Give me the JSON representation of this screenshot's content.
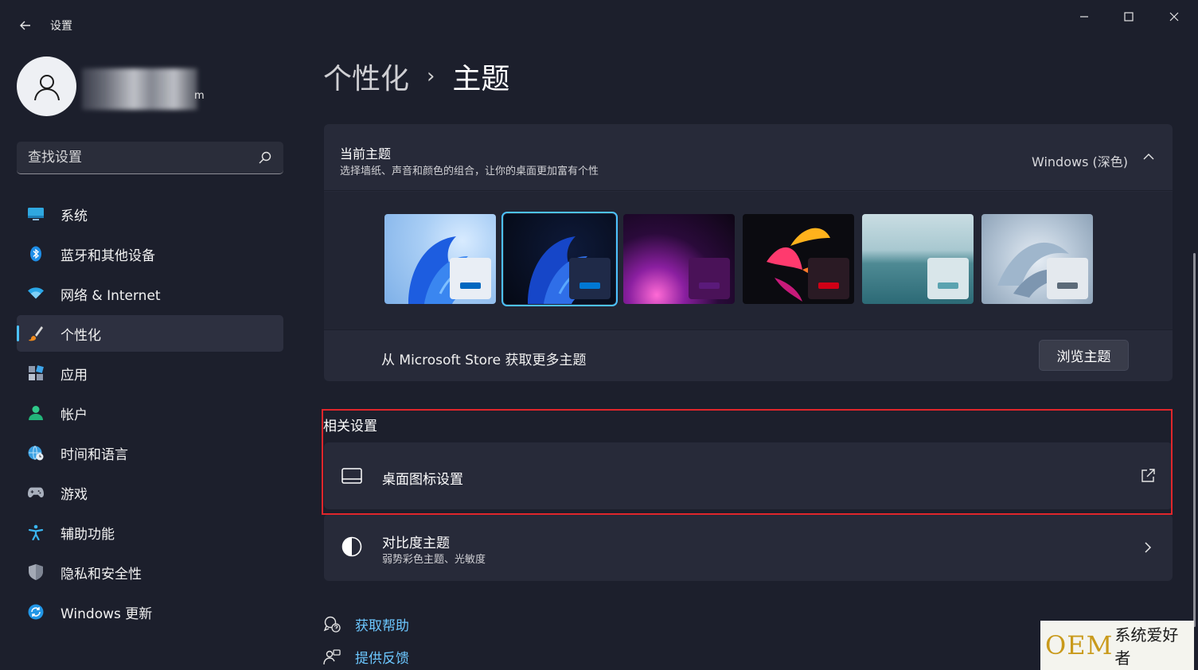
{
  "window": {
    "title": "设置"
  },
  "user": {
    "email_tail": "m"
  },
  "search": {
    "placeholder": "查找设置"
  },
  "sidebar": {
    "items": [
      {
        "label": "系统",
        "icon": "monitor-icon"
      },
      {
        "label": "蓝牙和其他设备",
        "icon": "bluetooth-icon"
      },
      {
        "label": "网络 & Internet",
        "icon": "wifi-icon"
      },
      {
        "label": "个性化",
        "icon": "brush-icon",
        "active": true
      },
      {
        "label": "应用",
        "icon": "apps-icon"
      },
      {
        "label": "帐户",
        "icon": "account-icon"
      },
      {
        "label": "时间和语言",
        "icon": "globe-clock-icon"
      },
      {
        "label": "游戏",
        "icon": "gamepad-icon"
      },
      {
        "label": "辅助功能",
        "icon": "accessibility-icon"
      },
      {
        "label": "隐私和安全性",
        "icon": "shield-icon"
      },
      {
        "label": "Windows 更新",
        "icon": "update-icon"
      }
    ]
  },
  "breadcrumb": {
    "parent": "个性化",
    "separator": "›",
    "current": "主题"
  },
  "current_theme": {
    "title": "当前主题",
    "subtitle": "选择墙纸、声音和颜色的组合，让你的桌面更加富有个性",
    "value": "Windows (深色)",
    "themes": [
      {
        "name": "windows-light",
        "accent": "#0067c0"
      },
      {
        "name": "windows-dark",
        "accent": "#0078d4",
        "selected": true
      },
      {
        "name": "glow",
        "accent": "#5a1a7a"
      },
      {
        "name": "captured-motion",
        "accent": "#d00016"
      },
      {
        "name": "sunrise",
        "accent": "#5aa3b0"
      },
      {
        "name": "flow",
        "accent": "#5b6a78"
      }
    ],
    "store_text": "从 Microsoft Store 获取更多主题",
    "browse_label": "浏览主题"
  },
  "related": {
    "title": "相关设置",
    "desktop_icons": {
      "title": "桌面图标设置"
    },
    "contrast": {
      "title": "对比度主题",
      "subtitle": "弱势彩色主题、光敏度"
    }
  },
  "links": {
    "help": "获取帮助",
    "feedback": "提供反馈"
  },
  "watermark": {
    "oem": "OEM",
    "text": "系统爱好者"
  },
  "colors": {
    "accent": "#4cc2ff",
    "highlight": "#e0262b",
    "background": "#1c1f2c",
    "card": "#272a39"
  }
}
